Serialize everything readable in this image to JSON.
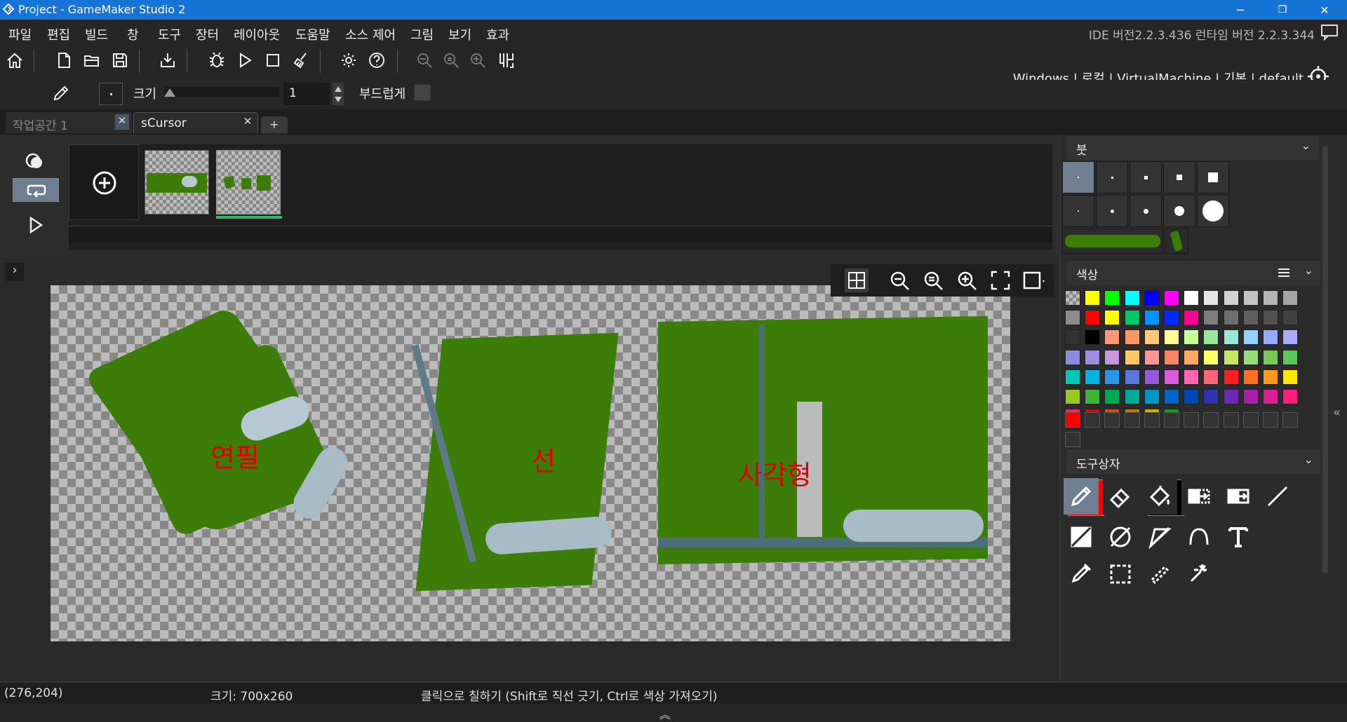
{
  "titlebar": {
    "title": "Project - GameMaker Studio 2",
    "minimize": "─",
    "restore": "❐",
    "close": "✕"
  },
  "menu": {
    "items": [
      "파일",
      "편집",
      "빌드",
      "창",
      "도구",
      "장터",
      "레이아웃",
      "도움말",
      "소스 제어",
      "그림",
      "보기",
      "효과"
    ],
    "ide_version": "IDE 버전2.2.3.436 런타임 버전 2.2.3.344"
  },
  "targets": {
    "platform": "Windows",
    "target": "로컬",
    "device": "VirtualMachine",
    "config": "기본",
    "profile": "default",
    "separator": "|"
  },
  "brushbar": {
    "size_label": "크기",
    "size_value": "1",
    "smooth_label": "부드럽게"
  },
  "tabs": [
    {
      "label": "작업공간 1",
      "close": "✕"
    },
    {
      "label": "sCursor",
      "close": "✕"
    }
  ],
  "tabs_add": "+",
  "frames": {
    "add_symbol": "+"
  },
  "canvas": {
    "labels": {
      "ellipse": "연필",
      "line": "선",
      "rect": "사각형"
    },
    "expand_symbol": "›"
  },
  "brush_panel": {
    "title": "붓"
  },
  "color_panel": {
    "title": "색상",
    "palette": [
      "checker",
      "#ffff00",
      "#00ff00",
      "#00ffff",
      "#0000ff",
      "#ff00ff",
      "#ffffff",
      "#e6e6e6",
      "#d2d2d2",
      "#c3c3c3",
      "#b4b4b4",
      "#a5a5a5",
      "#8c8c8c",
      "#ff0000",
      "#ffff00",
      "#00c864",
      "#0096ff",
      "#0028ff",
      "#ff0096",
      "#7d7d7d",
      "#6e6e6e",
      "#5f5f5f",
      "#505050",
      "#414141",
      "#323232",
      "#000000",
      "#ff9678",
      "#ff9664",
      "#ffc878",
      "#ffff96",
      "#c8ff96",
      "#96e69b",
      "#96e6d2",
      "#96d2ff",
      "#96aaff",
      "#aaaaff",
      "#8c8cdc",
      "#a08cdc",
      "#c896dc",
      "#ffc864",
      "#ff9696",
      "#ff8264",
      "#ffaa64",
      "#ffff64",
      "#c8e664",
      "#96dc78",
      "#78c85a",
      "#5ac85a",
      "#00c8b4",
      "#00b4e6",
      "#2896e6",
      "#5a78dc",
      "#965adc",
      "#dc5adc",
      "#ff64b4",
      "#ff6478",
      "#ff1e1e",
      "#ff6e1e",
      "#ff961e",
      "#ffe600",
      "#96c81e",
      "#3cb43c",
      "#00aa50",
      "#00aa96",
      "#0096c8",
      "#0064c8",
      "#0046b4",
      "#3232b4",
      "#6e28b4",
      "#aa1eaa",
      "#dc1e96",
      "#ff1e78",
      "#ff1e64",
      "#c80a1e",
      "#c8501e",
      "#c87800",
      "#c8b400",
      "#1e961e"
    ],
    "recent": [
      "#ff0000",
      "#333333",
      "#333333",
      "#333333",
      "#333333",
      "#333333",
      "#333333",
      "#333333",
      "#333333",
      "#333333",
      "#333333",
      "#333333",
      "#333333"
    ],
    "primary": "#ff0000",
    "secondary": "#000000"
  },
  "tools_panel": {
    "title": "도구상자"
  },
  "status": {
    "coords": "(276,204)",
    "size": "크기: 700x260",
    "hint": "클릭으로 칠하기 (Shift로 직선 긋기, Ctrl로 색상 가져오기)"
  },
  "bottom": {
    "toggle": "︽"
  }
}
